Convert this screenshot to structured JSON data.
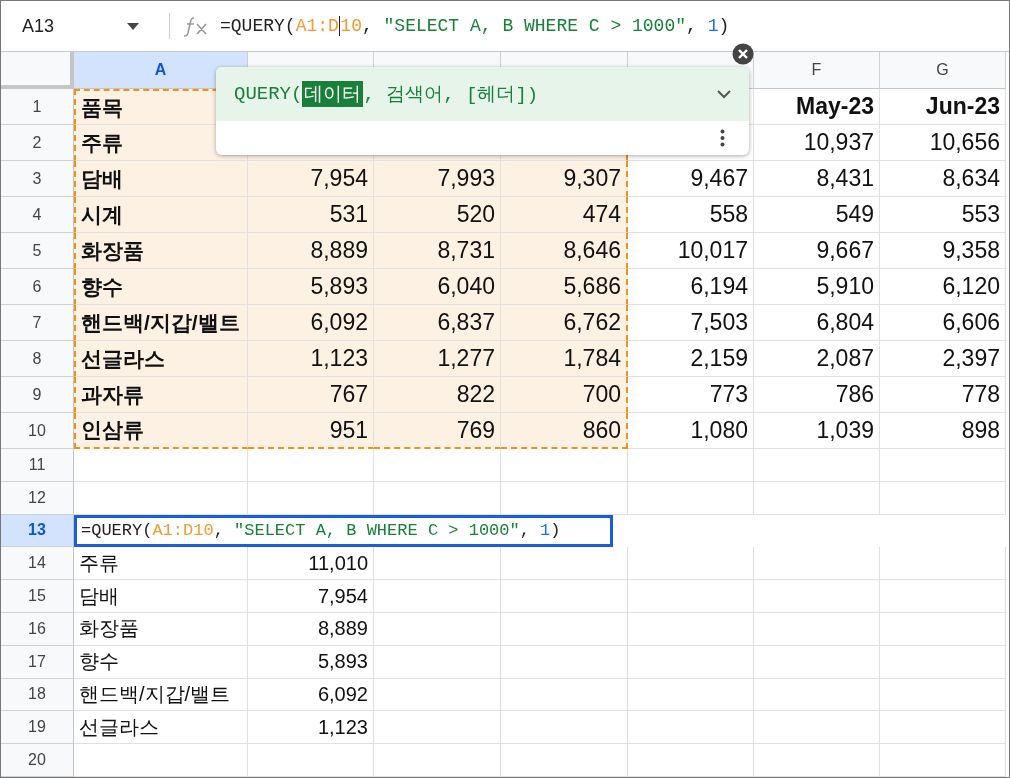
{
  "name_box": {
    "value": "A13"
  },
  "formula_bar": {
    "parts": [
      {
        "kind": "plain",
        "text": "=QUERY("
      },
      {
        "kind": "range",
        "text": "A1:D",
        "cursor_after": true
      },
      {
        "kind": "range",
        "text": "10"
      },
      {
        "kind": "plain",
        "text": ", "
      },
      {
        "kind": "string",
        "text": "\"SELECT A, B WHERE C > 1000\""
      },
      {
        "kind": "plain",
        "text": ", "
      },
      {
        "kind": "number",
        "text": "1"
      },
      {
        "kind": "plain",
        "text": ")"
      }
    ]
  },
  "function_help": {
    "parts": [
      {
        "kind": "plain",
        "text": "QUERY("
      },
      {
        "kind": "active",
        "text": "데이터"
      },
      {
        "kind": "plain",
        "text": ", 검색어, [헤더])"
      }
    ]
  },
  "columns": [
    {
      "label": "A",
      "selected": true,
      "in_range": true
    },
    {
      "selected": false,
      "in_range": true
    },
    {
      "selected": false,
      "in_range": true
    },
    {
      "selected": false,
      "in_range": true
    },
    {
      "selected": false,
      "in_range": false
    },
    {
      "label": "F",
      "selected": false,
      "in_range": false
    },
    {
      "label": "G",
      "selected": false,
      "in_range": false
    }
  ],
  "rows": [
    {
      "number": "1",
      "selected": false,
      "in_range": true,
      "header": true,
      "bold_label": true,
      "cells": [
        "품목",
        null,
        null,
        null,
        null,
        "May-23",
        "Jun-23"
      ]
    },
    {
      "number": "2",
      "selected": false,
      "in_range": true,
      "header": false,
      "bold_label": true,
      "cells": [
        "주류",
        null,
        null,
        null,
        null,
        "10,937",
        "10,656"
      ]
    },
    {
      "number": "3",
      "selected": false,
      "in_range": true,
      "header": false,
      "bold_label": true,
      "cells": [
        "담배",
        "7,954",
        "7,993",
        "9,307",
        "9,467",
        "8,431",
        "8,634"
      ]
    },
    {
      "number": "4",
      "selected": false,
      "in_range": true,
      "header": false,
      "bold_label": true,
      "cells": [
        "시계",
        "531",
        "520",
        "474",
        "558",
        "549",
        "553"
      ]
    },
    {
      "number": "5",
      "selected": false,
      "in_range": true,
      "header": false,
      "bold_label": true,
      "cells": [
        "화장품",
        "8,889",
        "8,731",
        "8,646",
        "10,017",
        "9,667",
        "9,358"
      ]
    },
    {
      "number": "6",
      "selected": false,
      "in_range": true,
      "header": false,
      "bold_label": true,
      "cells": [
        "향수",
        "5,893",
        "6,040",
        "5,686",
        "6,194",
        "5,910",
        "6,120"
      ]
    },
    {
      "number": "7",
      "selected": false,
      "in_range": true,
      "header": false,
      "bold_label": true,
      "cells": [
        "핸드백/지갑/밸트",
        "6,092",
        "6,837",
        "6,762",
        "7,503",
        "6,804",
        "6,606"
      ]
    },
    {
      "number": "8",
      "selected": false,
      "in_range": true,
      "header": false,
      "bold_label": true,
      "cells": [
        "선글라스",
        "1,123",
        "1,277",
        "1,784",
        "2,159",
        "2,087",
        "2,397"
      ]
    },
    {
      "number": "9",
      "selected": false,
      "in_range": true,
      "header": false,
      "bold_label": true,
      "cells": [
        "과자류",
        "767",
        "822",
        "700",
        "773",
        "786",
        "778"
      ]
    },
    {
      "number": "10",
      "selected": false,
      "in_range": true,
      "header": false,
      "bold_label": true,
      "cells": [
        "인삼류",
        "951",
        "769",
        "860",
        "1,080",
        "1,039",
        "898"
      ]
    },
    {
      "number": "11",
      "selected": false,
      "in_range": false,
      "cells": []
    },
    {
      "number": "12",
      "selected": false,
      "in_range": false,
      "cells": []
    },
    {
      "number": "13",
      "selected": true,
      "editor": {
        "parts": [
          {
            "kind": "plain",
            "text": "=QUERY("
          },
          {
            "kind": "range",
            "text": "A1:D10"
          },
          {
            "kind": "plain",
            "text": ", "
          },
          {
            "kind": "string",
            "text": "\"SELECT A, B WHERE C > 1000\""
          },
          {
            "kind": "plain",
            "text": ", "
          },
          {
            "kind": "number",
            "text": "1"
          },
          {
            "kind": "plain",
            "text": ")"
          }
        ]
      }
    },
    {
      "number": "14",
      "selected": false,
      "in_range": false,
      "header": false,
      "bold_label": false,
      "cells": [
        "주류",
        "11,010"
      ]
    },
    {
      "number": "15",
      "selected": false,
      "in_range": false,
      "header": false,
      "bold_label": false,
      "cells": [
        "담배",
        "7,954"
      ]
    },
    {
      "number": "16",
      "selected": false,
      "in_range": false,
      "header": false,
      "bold_label": false,
      "cells": [
        "화장품",
        "8,889"
      ]
    },
    {
      "number": "17",
      "selected": false,
      "in_range": false,
      "header": false,
      "bold_label": false,
      "cells": [
        "향수",
        "5,893"
      ]
    },
    {
      "number": "18",
      "selected": false,
      "in_range": false,
      "header": false,
      "bold_label": false,
      "cells": [
        "핸드백/지갑/밸트",
        "6,092"
      ]
    },
    {
      "number": "19",
      "selected": false,
      "in_range": false,
      "header": false,
      "bold_label": false,
      "cells": [
        "선글라스",
        "1,123"
      ]
    },
    {
      "number": "20",
      "selected": false,
      "in_range": false,
      "cells": []
    }
  ]
}
